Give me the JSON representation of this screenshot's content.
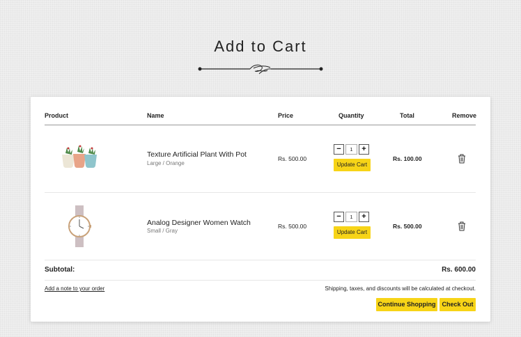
{
  "page": {
    "title": "Add to Cart"
  },
  "table": {
    "headers": {
      "product": "Product",
      "name": "Name",
      "price": "Price",
      "quantity": "Quantity",
      "total": "Total",
      "remove": "Remove"
    },
    "items": [
      {
        "name": "Texture Artificial Plant With Pot",
        "variant": "Large / Orange",
        "price": "Rs. 500.00",
        "quantity": "1",
        "total": "Rs. 100.00",
        "update_label": "Update Cart",
        "image_icon": "potted-plants-image"
      },
      {
        "name": "Analog Designer Women Watch",
        "variant": "Small / Gray",
        "price": "Rs. 500.00",
        "quantity": "1",
        "total": "Rs. 500.00",
        "update_label": "Update Cart",
        "image_icon": "wrist-watch-image"
      }
    ]
  },
  "summary": {
    "subtotal_label": "Subtotal:",
    "subtotal_value": "Rs. 600.00",
    "note_link": "Add a note to your order",
    "shipping_note": "Shipping, taxes, and discounts will be calculated at checkout."
  },
  "actions": {
    "continue_label": "Continue Shopping",
    "checkout_label": "Check Out"
  },
  "colors": {
    "accent": "#f7d417",
    "background": "#efefef",
    "card": "#ffffff"
  }
}
